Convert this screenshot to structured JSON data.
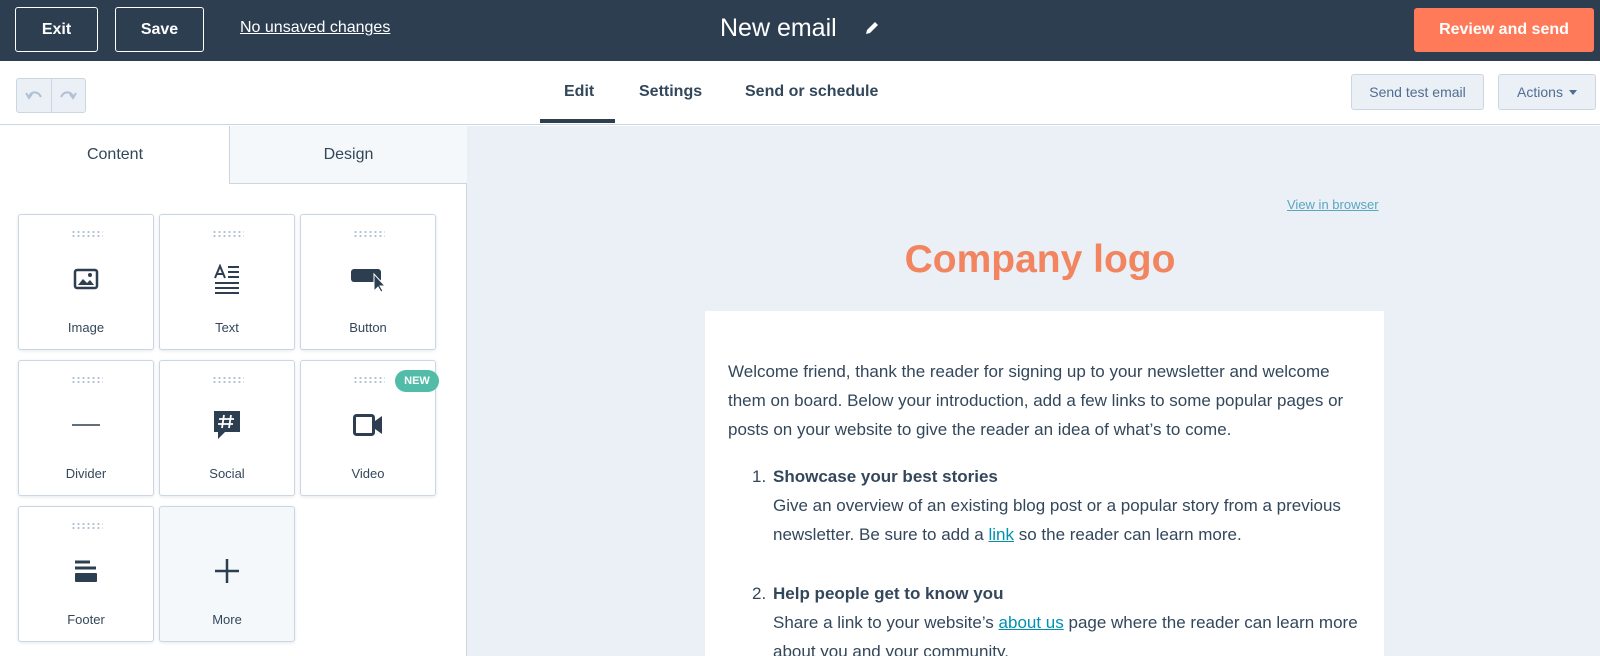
{
  "topbar": {
    "exit_label": "Exit",
    "save_label": "Save",
    "unsaved_label": "No unsaved changes",
    "email_title": "New email",
    "review_label": "Review and send"
  },
  "subbar": {
    "tabs": [
      {
        "label": "Edit",
        "active": true
      },
      {
        "label": "Settings"
      },
      {
        "label": "Send or schedule"
      }
    ],
    "send_test_label": "Send test email",
    "actions_label": "Actions"
  },
  "panel": {
    "tabs": [
      {
        "label": "Content",
        "active": true
      },
      {
        "label": "Design"
      }
    ],
    "tiles": [
      {
        "label": "Image",
        "icon": "image-icon"
      },
      {
        "label": "Text",
        "icon": "text-icon"
      },
      {
        "label": "Button",
        "icon": "button-icon"
      },
      {
        "label": "Divider",
        "icon": "divider-icon"
      },
      {
        "label": "Social",
        "icon": "social-icon"
      },
      {
        "label": "Video",
        "icon": "video-icon"
      },
      {
        "label": "Footer",
        "icon": "footer-icon"
      },
      {
        "label": "More",
        "icon": "plus-icon"
      }
    ],
    "new_badge": "NEW"
  },
  "email": {
    "view_in_browser": "View in browser",
    "logo": "Company logo",
    "intro": "Welcome friend, thank the reader for signing up to your newsletter and welcome them on board. Below your introduction, add a few links to some popular pages or posts on your website to give the reader an idea of what’s to come.",
    "items": [
      {
        "num": "1.",
        "title": "Showcase your best stories",
        "body_before": "Give an overview of an existing blog post or a popular story from a previous newsletter. Be sure to add a ",
        "link": "link",
        "body_after": " so the reader can learn more."
      },
      {
        "num": "2.",
        "title": "Help people get to know you",
        "body_before": "Share a link to your website’s ",
        "link": "about us",
        "body_after": " page where the reader can learn more about you and your community."
      }
    ]
  },
  "colors": {
    "topbar": "#2d3e50",
    "accent": "#ff7a59",
    "logo": "#f2845f",
    "new_badge": "#51bca7",
    "link": "#0091ae"
  }
}
